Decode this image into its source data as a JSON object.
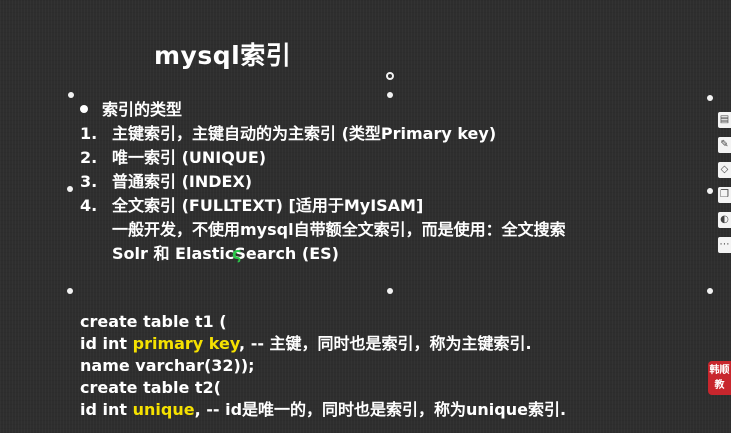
{
  "slide": {
    "title": "mysql索引"
  },
  "index_types": {
    "heading": "索引的类型",
    "items": [
      {
        "num": "1.",
        "text": "主键索引，主键自动的为主索引 (类型Primary key)"
      },
      {
        "num": "2.",
        "text": "唯一索引 (UNIQUE)"
      },
      {
        "num": "3.",
        "text": "普通索引 (INDEX)"
      },
      {
        "num": "4.",
        "text": "全文索引 (FULLTEXT) [适用于MyISAM]"
      }
    ],
    "note_line1": "一般开发，不使用mysql自带额全文索引，而是使用：全文搜索",
    "note_line2": "Solr 和 ElasticSearch (ES)"
  },
  "code": {
    "l1": "create table t1 (",
    "l2_pre": "id int ",
    "l2_kw": "primary key",
    "l2_post": ", -- 主键，同时也是索引，称为主键索引.",
    "l3": "name varchar(32));",
    "l4": "create table t2(",
    "l5_pre": "id int ",
    "l5_kw": "unique",
    "l5_post": ", -- id是唯一的，同时也是索引，称为unique索引."
  },
  "toolbar": {
    "icons": [
      "note-icon",
      "pen-icon",
      "eraser-icon",
      "copy-icon",
      "palette-icon",
      "more-icon"
    ]
  },
  "badge": {
    "line1": "韩顺",
    "line2": "教"
  },
  "colors": {
    "background": "#2e2e2e",
    "text": "#ffffff",
    "keyword": "#f5e100",
    "badge": "#c8262d"
  }
}
